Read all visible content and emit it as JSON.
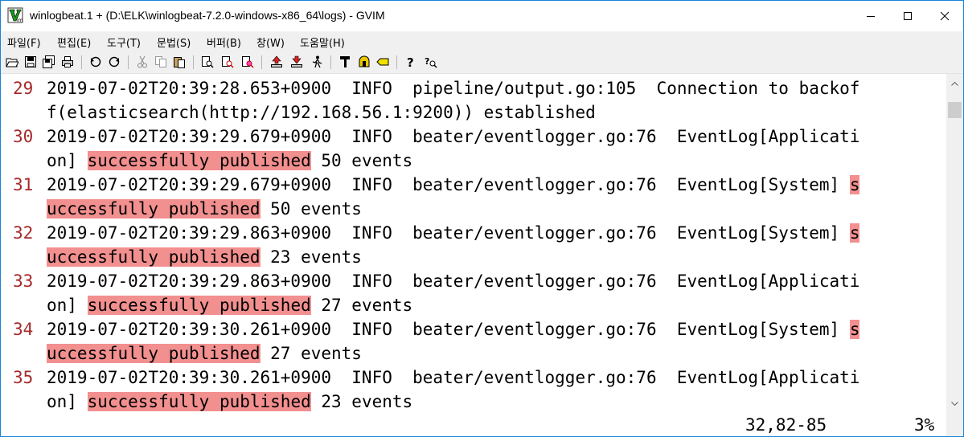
{
  "window": {
    "title": "winlogbeat.1 + (D:\\ELK\\winlogbeat-7.2.0-windows-x86_64\\logs) - GVIM"
  },
  "menu": [
    {
      "label": "파일(F)"
    },
    {
      "label": "편집(E)"
    },
    {
      "label": "도구(T)"
    },
    {
      "label": "문법(S)"
    },
    {
      "label": "버퍼(B)"
    },
    {
      "label": "창(W)"
    },
    {
      "label": "도움말(H)"
    }
  ],
  "toolbar": {
    "icons": [
      "open-icon",
      "save-icon",
      "save-all-icon",
      "print-icon",
      "undo-icon",
      "redo-icon",
      "cut-icon",
      "copy-icon",
      "paste-icon",
      "find-replace-icon",
      "find-next-icon",
      "find-prev-icon",
      "load-session-icon",
      "save-session-icon",
      "run-script-icon",
      "make-icon",
      "run-ctags-icon",
      "jump-tag-icon",
      "help-icon",
      "find-help-icon"
    ]
  },
  "editor": {
    "highlight_color": "#f28f8f",
    "line_number_color": "#a52a2a",
    "lines": [
      {
        "num": "29",
        "row1": [
          {
            "t": "2019-07-02T20:39:28.653+0900  INFO  pipeline/output.go:105  Connection to backof"
          }
        ],
        "row2": [
          {
            "t": "f(elasticsearch(http://192.168.56.1:9200)) established"
          }
        ]
      },
      {
        "num": "30",
        "row1": [
          {
            "t": "2019-07-02T20:39:29.679+0900  INFO  beater/eventlogger.go:76  EventLog[Applicati"
          }
        ],
        "row2": [
          {
            "t": "on] "
          },
          {
            "t": "successfully published",
            "hl": true
          },
          {
            "t": " 50 events"
          }
        ]
      },
      {
        "num": "31",
        "row1": [
          {
            "t": "2019-07-02T20:39:29.679+0900  INFO  beater/eventlogger.go:76  EventLog[System] "
          },
          {
            "t": "s",
            "hl": true
          }
        ],
        "row2": [
          {
            "t": "uccessfully published",
            "hl": true
          },
          {
            "t": " 50 events"
          }
        ]
      },
      {
        "num": "32",
        "row1": [
          {
            "t": "2019-07-02T20:39:29.863+0900  INFO  beater/eventlogger.go:76  EventLog[System] "
          },
          {
            "t": "s",
            "hl": true
          }
        ],
        "row2": [
          {
            "t": "uccessfully published",
            "hl": true
          },
          {
            "t": " 23 events"
          }
        ]
      },
      {
        "num": "33",
        "row1": [
          {
            "t": "2019-07-02T20:39:29.863+0900  INFO  beater/eventlogger.go:76  EventLog[Applicati"
          }
        ],
        "row2": [
          {
            "t": "on] "
          },
          {
            "t": "successfully published",
            "hl": true
          },
          {
            "t": " 27 events"
          }
        ]
      },
      {
        "num": "34",
        "row1": [
          {
            "t": "2019-07-02T20:39:30.261+0900  INFO  beater/eventlogger.go:76  EventLog[System] "
          },
          {
            "t": "s",
            "hl": true
          }
        ],
        "row2": [
          {
            "t": "uccessfully published",
            "hl": true
          },
          {
            "t": " 27 events"
          }
        ]
      },
      {
        "num": "35",
        "row1": [
          {
            "t": "2019-07-02T20:39:30.261+0900  INFO  beater/eventlogger.go:76  EventLog[Applicati"
          }
        ],
        "row2": [
          {
            "t": "on] "
          },
          {
            "t": "successfully published",
            "hl": true
          },
          {
            "t": " 23 events"
          }
        ]
      }
    ]
  },
  "status": {
    "position": "32,82-85",
    "percent": "3%"
  }
}
